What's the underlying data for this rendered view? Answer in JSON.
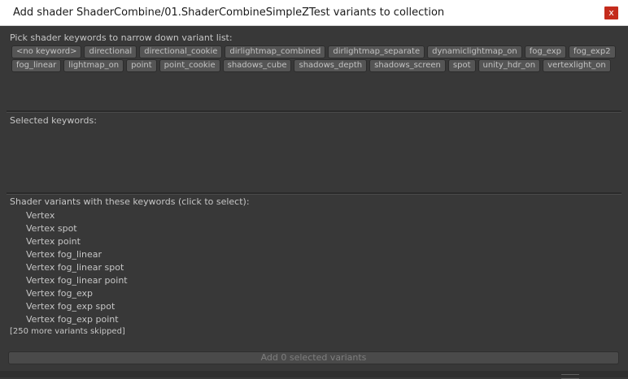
{
  "window": {
    "title": "Add shader ShaderCombine/01.ShaderCombineSimpleZTest variants to collection",
    "close_label": "x"
  },
  "keywords_section": {
    "label": "Pick shader keywords to narrow down variant list:",
    "rows": [
      [
        "<no keyword>",
        "directional",
        "directional_cookie",
        "dirlightmap_combined",
        "dirlightmap_separate",
        "dynamiclightmap_on",
        "fog_exp",
        "fog_exp2"
      ],
      [
        "fog_linear",
        "lightmap_on",
        "point",
        "point_cookie",
        "shadows_cube",
        "shadows_depth",
        "shadows_screen",
        "spot",
        "unity_hdr_on",
        "vertexlight_on"
      ]
    ]
  },
  "selected_section": {
    "label": "Selected keywords:"
  },
  "variants_section": {
    "label": "Shader variants with these keywords (click to select):",
    "items": [
      "Vertex",
      "Vertex spot",
      "Vertex point",
      "Vertex fog_linear",
      "Vertex fog_linear spot",
      "Vertex fog_linear point",
      "Vertex fog_exp",
      "Vertex fog_exp spot",
      "Vertex fog_exp point"
    ],
    "skipped_note": "[250 more variants skipped]"
  },
  "footer": {
    "add_button_label": "Add 0 selected variants"
  }
}
